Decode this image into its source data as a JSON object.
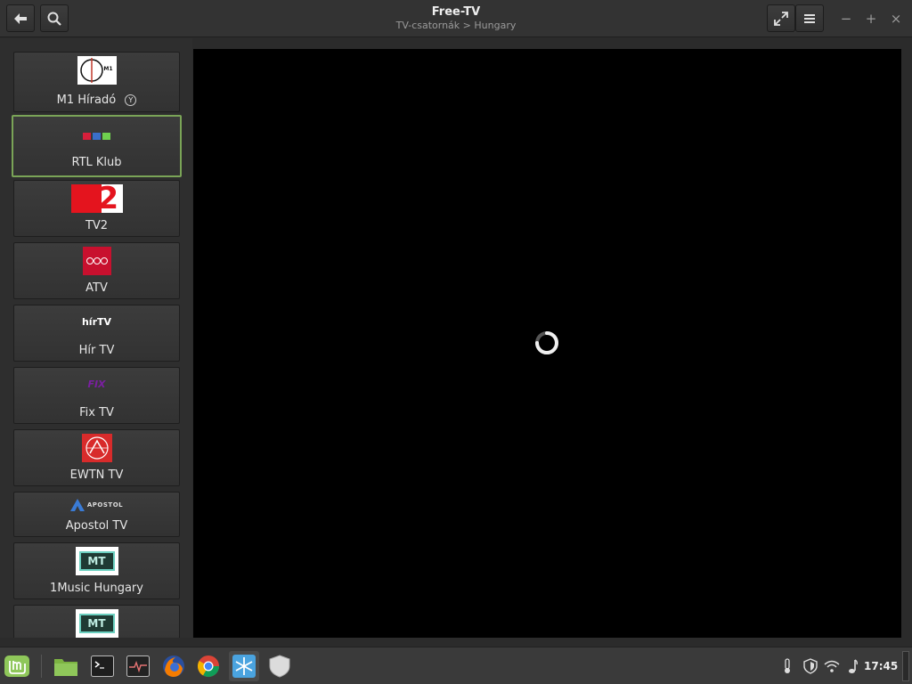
{
  "header": {
    "title": "Free-TV",
    "subtitle": "TV-csatornák > Hungary",
    "back_icon": "arrow-left-icon",
    "search_icon": "search-icon",
    "fullscreen_icon": "fullscreen-icon",
    "menu_icon": "hamburger-menu-icon",
    "minimize": "−",
    "maximize": "+",
    "close": "×"
  },
  "channels": [
    {
      "label": "M1 Híradó",
      "badge": "Y",
      "logo_text": "M1",
      "logo": "m1-logo"
    },
    {
      "label": "RTL Klub",
      "logo_text": "R T L",
      "logo": "rtl-logo",
      "selected": true
    },
    {
      "label": "TV2",
      "logo_text": "2",
      "logo": "tv2-logo"
    },
    {
      "label": "ATV",
      "logo_text": "ATV",
      "logo": "atv-logo"
    },
    {
      "label": "Hír TV",
      "logo_text": "hírTV",
      "logo": "hirtv-logo"
    },
    {
      "label": "Fix TV",
      "logo_text": "FIX",
      "logo": "fixtv-logo"
    },
    {
      "label": "EWTN TV",
      "logo_text": "",
      "logo": "ewtn-logo"
    },
    {
      "label": "Apostol TV",
      "logo_text": "APOSTOL",
      "logo": "apostol-logo"
    },
    {
      "label": "1Music Hungary",
      "logo_text": "MT",
      "logo": "1music-logo"
    },
    {
      "label": "",
      "logo_text": "MT",
      "logo": "1music-logo"
    }
  ],
  "video": {
    "state": "loading"
  },
  "taskbar": {
    "apps": [
      "mint-menu-icon",
      "files-icon",
      "terminal-icon",
      "system-monitor-icon",
      "firefox-icon",
      "chrome-icon",
      "snowflake-icon",
      "shield-icon"
    ],
    "tray": [
      "thermometer-icon",
      "shield-tray-icon",
      "wifi-icon",
      "sound-icon"
    ],
    "clock": "17:45"
  },
  "colors": {
    "selected_border": "#7aa457",
    "background": "#2b2b2b",
    "video": "#000000"
  }
}
